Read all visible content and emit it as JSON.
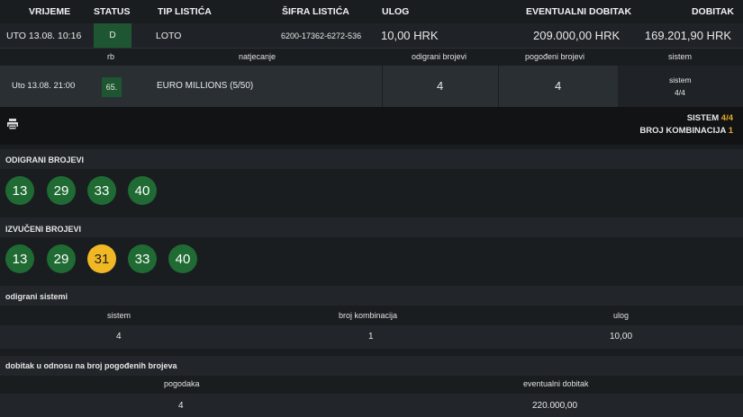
{
  "header": {
    "vrijeme": "VRIJEME",
    "status": "STATUS",
    "tip": "TIP LISTIĆA",
    "sifra": "ŠIFRA LISTIĆA",
    "ulog": "ULOG",
    "eventualni": "EVENTUALNI DOBITAK",
    "dobitak": "DOBITAK"
  },
  "ticket": {
    "vrijeme": "UTO 13.08. 10:16",
    "status": "D",
    "tip": "LOTO",
    "sifra": "6200-17362-6272-536",
    "ulog": "10,00 HRK",
    "eventualni": "209.000,00 HRK",
    "dobitak": "169.201,90 HRK"
  },
  "event_header": {
    "rb": "rb",
    "natjecanje": "natjecanje",
    "odigrani": "odigrani brojevi",
    "pogodeni": "pogođeni brojevi",
    "sistem": "sistem"
  },
  "event": {
    "vrijeme": "Uto 13.08. 21:00",
    "rb": "65.",
    "natjecanje": "EURO MILLIONS (5/50)",
    "odigrani": "4",
    "pogodeni": "4",
    "sistem_label": "sistem",
    "sistem_value": "4/4"
  },
  "summary": {
    "sistem_label": "SISTEM",
    "sistem_value": "4/4",
    "kombinacija_label": "BROJ KOMBINACIJA",
    "kombinacija_value": "1"
  },
  "played": {
    "title": "ODIGRANI BROJEVI",
    "numbers": [
      "13",
      "29",
      "33",
      "40"
    ]
  },
  "drawn": {
    "title": "IZVUČENI BROJEVI",
    "numbers": [
      "13",
      "29",
      "31",
      "33",
      "40"
    ],
    "hit_color": "#f0b824",
    "ball_color": "#1f6b33"
  },
  "systems": {
    "title": "odigrani sistemi",
    "col_sistem": "sistem",
    "col_kombinacija": "broj kombinacija",
    "col_ulog": "ulog",
    "sistem": "4",
    "kombinacija": "1",
    "ulog": "10,00"
  },
  "winnings": {
    "title": "dobitak u odnosu na broj pogođenih brojeva",
    "col_pogodaka": "pogodaka",
    "col_eventualni": "eventualni dobitak",
    "pogodaka": "4",
    "eventualni": "220.000,00"
  },
  "icons": {
    "print": "printer-icon"
  },
  "colors": {
    "accent": "#e8a92a",
    "status_green": "#1e5631"
  }
}
